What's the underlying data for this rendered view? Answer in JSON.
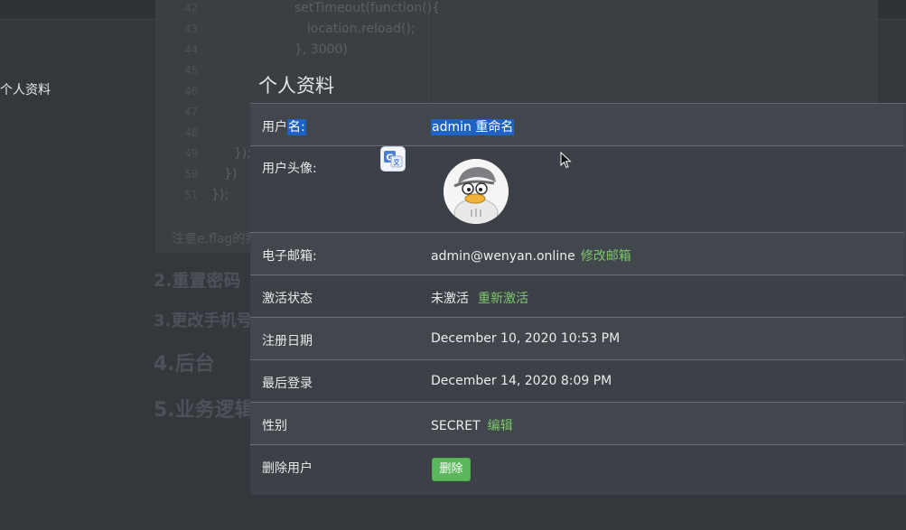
{
  "background_doc": {
    "line_numbers": [
      "42",
      "43",
      "44",
      "45",
      "46",
      "47",
      "48",
      "49",
      "50",
      "51"
    ],
    "code_lines": [
      "setTimeout(function(){",
      "location.reload();",
      "}, 3000)",
      "})",
      "});",
      "})",
      "});"
    ],
    "note": "注意e.flag的判断",
    "headings": [
      "2.重置密码",
      "3.更改手机号码",
      "4.后台",
      "5.业务逻辑"
    ]
  },
  "sidebar": {
    "item_label": "个人资料"
  },
  "panel": {
    "title": "个人资料",
    "rows": {
      "username": {
        "label_prefix": "用户",
        "label_selected": "名:",
        "value": "admin 重命名"
      },
      "avatar": {
        "label": "用户头像:"
      },
      "email": {
        "label": "电子邮箱:",
        "value": "admin@wenyan.online",
        "action": "修改邮箱"
      },
      "activation": {
        "label": "激活状态",
        "value": "未激活",
        "action": "重新激活"
      },
      "registered": {
        "label": "注册日期",
        "value": "December 10, 2020 10:53 PM"
      },
      "last_login": {
        "label": "最后登录",
        "value": "December 14, 2020 8:09 PM"
      },
      "gender": {
        "label": "性别",
        "value": "SECRET",
        "action": "编辑"
      },
      "delete": {
        "label": "删除用户",
        "button": "删除"
      }
    }
  },
  "colors": {
    "background": "#34383d",
    "panel": "#3f444a",
    "selection": "#1e63c4",
    "link": "#7fc66b",
    "delete_button": "#5cb85c"
  },
  "icons": [
    "google-translate-icon",
    "mouse-pointer-icon",
    "avatar-duck-icon"
  ]
}
